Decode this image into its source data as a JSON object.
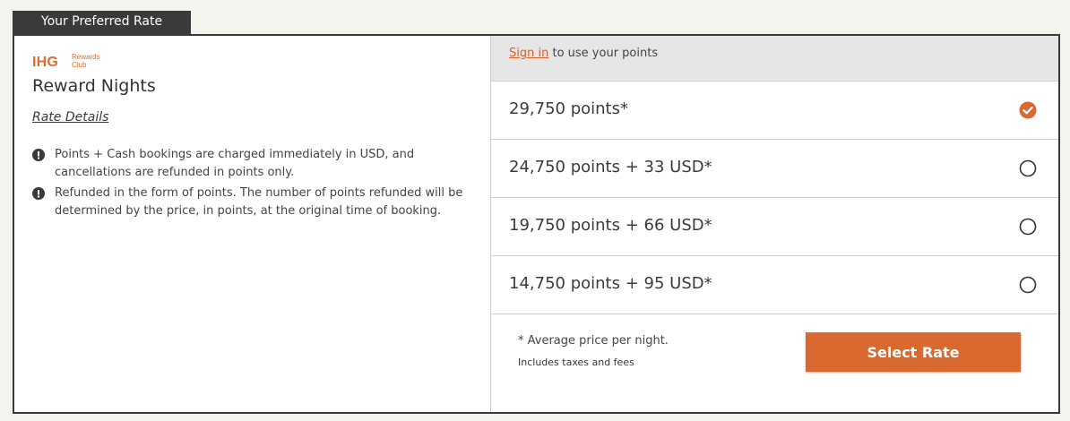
{
  "tab": {
    "label": "Your Preferred Rate"
  },
  "brand": {
    "logo_text": "IHG",
    "logo_sub": "Rewards Club",
    "accent": "#d9692f"
  },
  "rate": {
    "title": "Reward Nights",
    "details_link": "Rate Details",
    "notes": [
      "Points + Cash bookings are charged immediately in USD, and cancellations are refunded in points only.",
      "Refunded in the form of points. The number of points refunded will be determined by the price, in points, at the original time of booking."
    ]
  },
  "signin": {
    "link": "Sign in",
    "text": " to use your points"
  },
  "options": [
    {
      "label": "29,750 points*",
      "selected": true
    },
    {
      "label": "24,750 points + 33 USD*",
      "selected": false
    },
    {
      "label": "19,750 points + 66 USD*",
      "selected": false
    },
    {
      "label": "14,750 points + 95 USD*",
      "selected": false
    }
  ],
  "footer": {
    "note": "*  Average price per night.",
    "taxes": "Includes taxes and fees",
    "button": "Select Rate"
  }
}
